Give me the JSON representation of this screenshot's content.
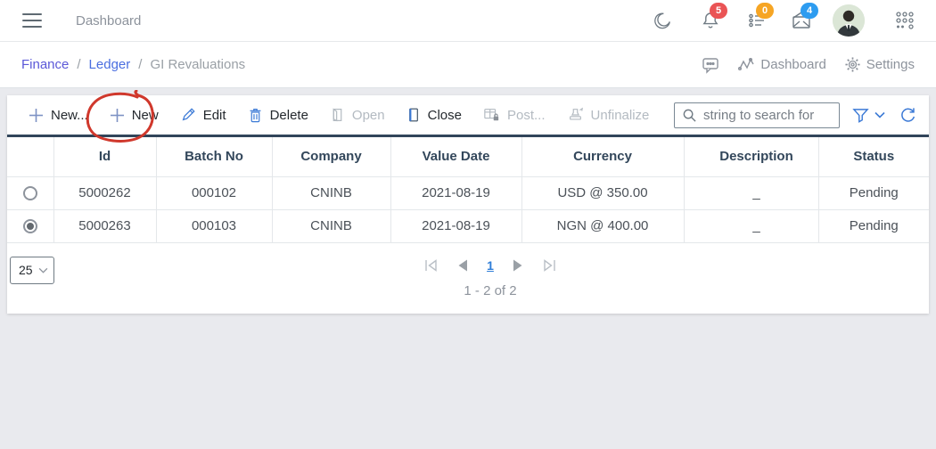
{
  "topbar": {
    "title": "Dashboard",
    "notification_count": "5",
    "task_count": "0",
    "message_count": "4",
    "badge_colors": {
      "notifications": "#ea5455",
      "tasks": "#f6a524",
      "messages": "#2d9cf0"
    }
  },
  "breadcrumb": {
    "separator": "/",
    "items": [
      {
        "label": "Finance"
      },
      {
        "label": "Ledger"
      },
      {
        "label": "GI Revaluations"
      }
    ],
    "right_links": {
      "dashboard": "Dashboard",
      "settings": "Settings"
    }
  },
  "toolbar": {
    "buttons": [
      {
        "label": "New...",
        "enabled": true
      },
      {
        "label": "New",
        "enabled": true,
        "annotated": true
      },
      {
        "label": "Edit",
        "enabled": true
      },
      {
        "label": "Delete",
        "enabled": true
      },
      {
        "label": "Open",
        "enabled": false
      },
      {
        "label": "Close",
        "enabled": true
      },
      {
        "label": "Post...",
        "enabled": false
      },
      {
        "label": "Unfinalize",
        "enabled": false
      }
    ],
    "search_placeholder": "string to search for"
  },
  "table": {
    "columns": [
      "Id",
      "Batch No",
      "Company",
      "Value Date",
      "Currency",
      "Description",
      "Status"
    ],
    "rows": [
      {
        "selected": false,
        "id": "5000262",
        "batch_no": "000102",
        "company": "CNINB",
        "value_date": "2021-08-19",
        "currency": "USD @ 350.00",
        "description": "_",
        "status": "Pending"
      },
      {
        "selected": true,
        "id": "5000263",
        "batch_no": "000103",
        "company": "CNINB",
        "value_date": "2021-08-19",
        "currency": "NGN @ 400.00",
        "description": "_",
        "status": "Pending"
      }
    ]
  },
  "pagination": {
    "page_size": "25",
    "current_page": "1",
    "range_text": "1 - 2 of 2"
  },
  "annotation": {
    "shape": "hand-drawn-ellipse",
    "target": "New button",
    "color": "#d0382c"
  },
  "colors": {
    "navy_divider": "#31455a",
    "id_link": "#4649d4",
    "accent_blue": "#3c7ad6",
    "breadcrumb_link1": "#5b58d8",
    "breadcrumb_link2": "#4a6ee0",
    "background": "#e9eaee"
  }
}
